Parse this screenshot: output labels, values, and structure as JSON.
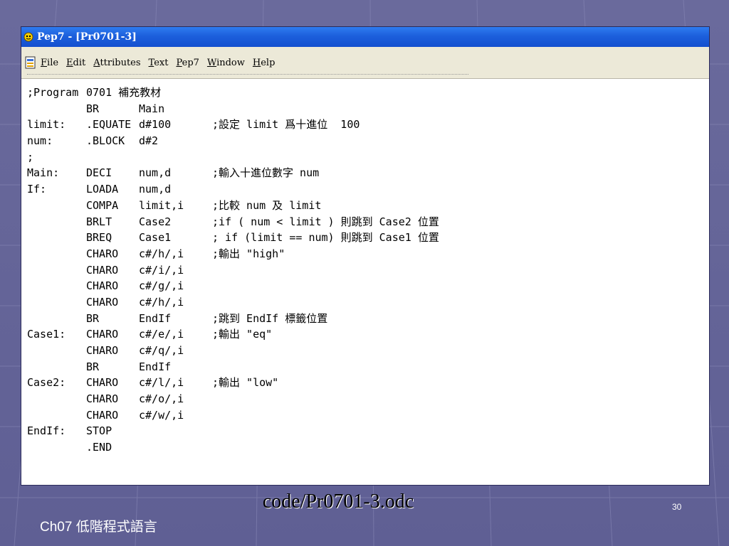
{
  "window": {
    "title": "Pep7 - [Pr0701-3]"
  },
  "menu": [
    {
      "u": "F",
      "rest": "ile"
    },
    {
      "u": "E",
      "rest": "dit"
    },
    {
      "u": "A",
      "rest": "ttributes"
    },
    {
      "u": "T",
      "rest": "ext"
    },
    {
      "u": "P",
      "rest": "ep7"
    },
    {
      "u": "W",
      "rest": "indow"
    },
    {
      "u": "H",
      "rest": "elp"
    }
  ],
  "code": [
    {
      "label": ";Program",
      "op": "0701 補充教材",
      "arg": "",
      "cmt": ""
    },
    {
      "label": "",
      "op": "BR",
      "arg": "Main",
      "cmt": ""
    },
    {
      "label": "limit:",
      "op": ".EQUATE",
      "arg": "d#100",
      "cmt": ";設定 limit 爲十進位  100"
    },
    {
      "label": "num:",
      "op": ".BLOCK",
      "arg": "d#2",
      "cmt": ""
    },
    {
      "label": ";",
      "op": "",
      "arg": "",
      "cmt": ""
    },
    {
      "label": "Main:",
      "op": "DECI",
      "arg": "num,d",
      "cmt": ";輸入十進位數字 num"
    },
    {
      "label": "If:",
      "op": "LOADA",
      "arg": "num,d",
      "cmt": ""
    },
    {
      "label": "",
      "op": "COMPA",
      "arg": "limit,i",
      "cmt": ";比較 num 及 limit"
    },
    {
      "label": "",
      "op": "BRLT",
      "arg": "Case2",
      "cmt": ";if ( num < limit ) 則跳到 Case2 位置"
    },
    {
      "label": "",
      "op": "BREQ",
      "arg": "Case1",
      "cmt": "; if (limit == num) 則跳到 Case1 位置"
    },
    {
      "label": "",
      "op": "CHARO",
      "arg": "c#/h/,i",
      "cmt": ";輸出 \"high\""
    },
    {
      "label": "",
      "op": "CHARO",
      "arg": "c#/i/,i",
      "cmt": ""
    },
    {
      "label": "",
      "op": "CHARO",
      "arg": "c#/g/,i",
      "cmt": ""
    },
    {
      "label": "",
      "op": "CHARO",
      "arg": "c#/h/,i",
      "cmt": ""
    },
    {
      "label": "",
      "op": "BR",
      "arg": "EndIf",
      "cmt": ";跳到 EndIf 標籤位置"
    },
    {
      "label": "Case1:",
      "op": "CHARO",
      "arg": "c#/e/,i",
      "cmt": ";輸出 \"eq\""
    },
    {
      "label": "",
      "op": "CHARO",
      "arg": "c#/q/,i",
      "cmt": ""
    },
    {
      "label": "",
      "op": "BR",
      "arg": "EndIf",
      "cmt": ""
    },
    {
      "label": "Case2:",
      "op": "CHARO",
      "arg": "c#/l/,i",
      "cmt": ";輸出 \"low\""
    },
    {
      "label": "",
      "op": "CHARO",
      "arg": "c#/o/,i",
      "cmt": ""
    },
    {
      "label": "",
      "op": "CHARO",
      "arg": "c#/w/,i",
      "cmt": ""
    },
    {
      "label": "EndIf:",
      "op": "STOP",
      "arg": "",
      "cmt": ""
    },
    {
      "label": "",
      "op": ".END",
      "arg": "",
      "cmt": ""
    }
  ],
  "slide": {
    "caption": "code/Pr0701-3.odc",
    "page_number": "30",
    "footer": "Ch07 低階程式語言"
  }
}
